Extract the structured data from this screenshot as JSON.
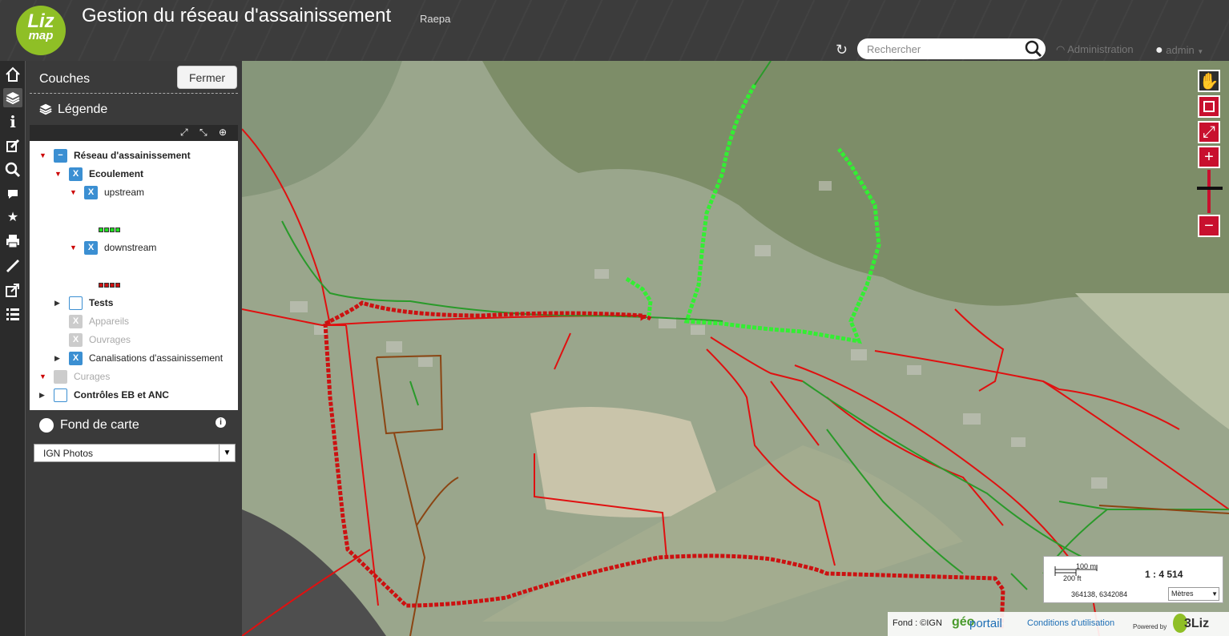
{
  "header": {
    "logo_line1": "Liz",
    "logo_line2": "map",
    "title": "Gestion du réseau d'assainissement",
    "subtitle": "Raepa",
    "search_placeholder": "Rechercher",
    "admin_label": "Administration",
    "user_label": "admin"
  },
  "toolbar": {
    "items": [
      "home-icon",
      "layers-icon",
      "info-icon",
      "edit-icon",
      "search-icon",
      "comment-icon",
      "star-icon",
      "print-icon",
      "measure-icon",
      "share-icon",
      "list-icon"
    ]
  },
  "panel": {
    "couches_title": "Couches",
    "close_label": "Fermer",
    "legend_title": "Légende",
    "tree": [
      {
        "label": "Réseau d'assainissement",
        "checked": "−"
      },
      {
        "label": "Ecoulement",
        "checked": "X"
      },
      {
        "label": "upstream",
        "checked": "X"
      },
      {
        "label": "downstream",
        "checked": "X"
      },
      {
        "label": "Tests",
        "checked": ""
      },
      {
        "label": "Appareils",
        "checked": "X"
      },
      {
        "label": "Ouvrages",
        "checked": "X"
      },
      {
        "label": "Canalisations d'assainissement",
        "checked": "X"
      },
      {
        "label": "Curages",
        "checked": ""
      },
      {
        "label": "Contrôles EB et ANC",
        "checked": ""
      }
    ],
    "basemap_title": "Fond de carte",
    "basemap_value": "IGN Photos"
  },
  "map": {
    "scale_top": "100 m",
    "scale_bottom": "200 ft",
    "scale_ratio": "1 : 4 514",
    "coordinates": "364138, 6342084",
    "unit": "Mètres",
    "attribution_fond": "Fond : ©IGN",
    "attribution_geo": "géo",
    "attribution_portail": "portail",
    "conditions": "Conditions d'utilisation",
    "powered": "Powered by",
    "brand": "3Liz",
    "colors": {
      "upstream": "#22dd22",
      "downstream": "#cc1111",
      "pipes": "#e01010",
      "green_lines": "#2a9a2a",
      "brown_lines": "#8b4513"
    }
  }
}
